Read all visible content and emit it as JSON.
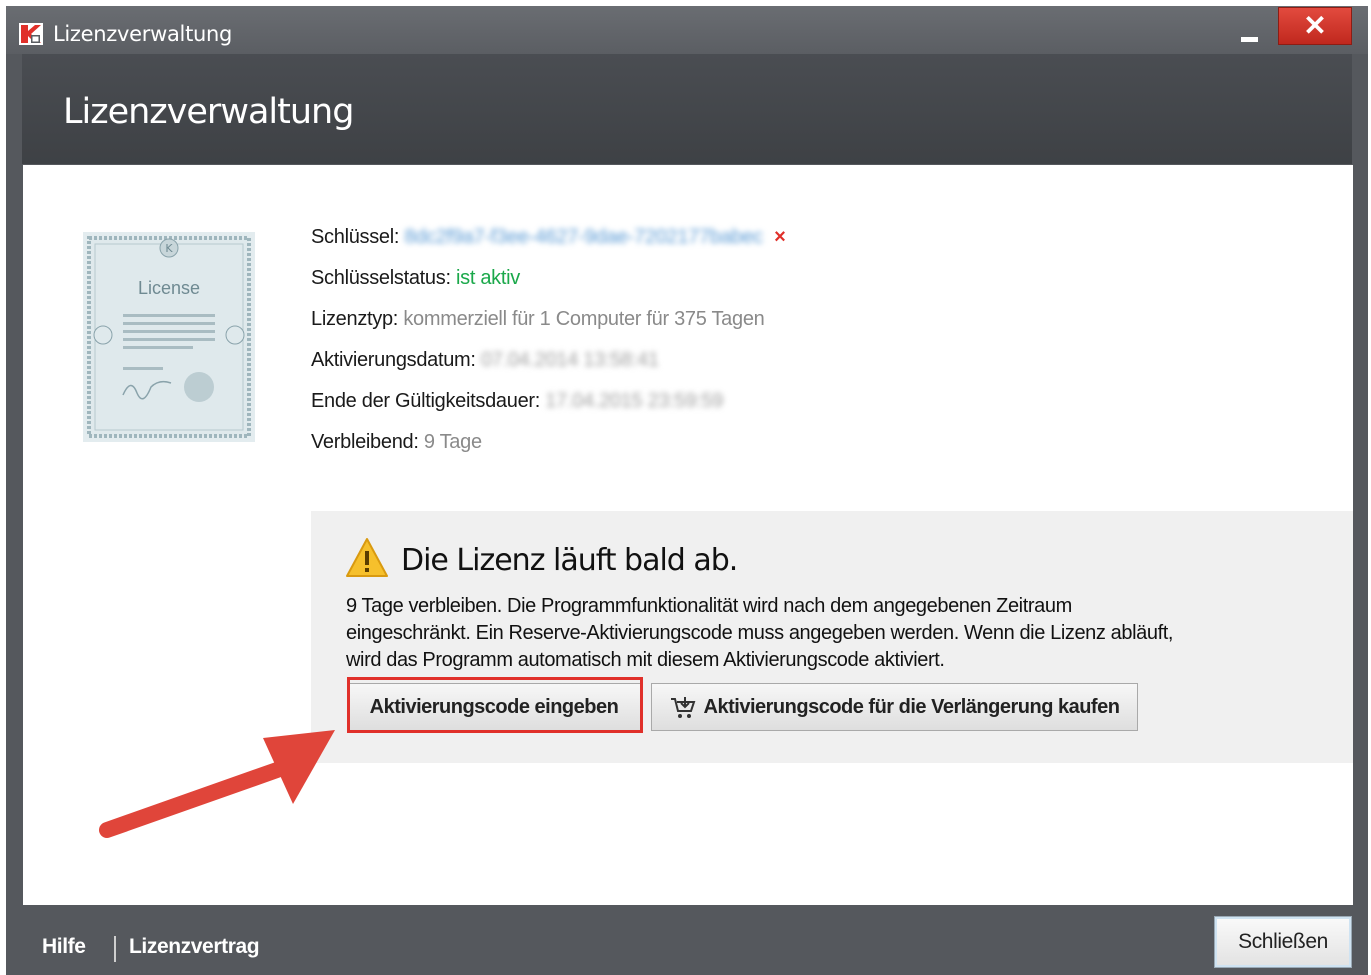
{
  "window": {
    "title": "Lizenzverwaltung",
    "close_label": "✕"
  },
  "header": {
    "title": "Lizenzverwaltung"
  },
  "certificate": {
    "label": "License"
  },
  "license": {
    "key_label": "Schlüssel:",
    "key_value": "8dc2f9a7-f3ee-4627-9dae-7202177babec",
    "key_remove": "×",
    "status_label": "Schlüsselstatus:",
    "status_value": "ist aktiv",
    "type_label": "Lizenztyp:",
    "type_value": "kommerziell für 1 Computer für 375 Tagen",
    "activation_label": "Aktivierungsdatum:",
    "activation_value": "07.04.2014 13:58:41",
    "expiry_label": "Ende der Gültigkeitsdauer:",
    "expiry_value": "17.04.2015 23:59:59",
    "remaining_label": "Verbleibend:",
    "remaining_value": "9 Tage"
  },
  "warning": {
    "title": "Die Lizenz läuft bald ab.",
    "line1": "9 Tage verbleiben. Die Programmfunktionalität wird nach dem angegebenen Zeitraum",
    "line2": "eingeschränkt. Ein Reserve-Aktivierungscode muss angegeben werden. Wenn die Lizenz abläuft,",
    "line3": "wird das Programm automatisch mit diesem Aktivierungscode aktiviert.",
    "btn_activate": "Aktivierungscode eingeben",
    "btn_buy": "Aktivierungscode für die Verlängerung kaufen"
  },
  "footer": {
    "help": "Hilfe",
    "license_agreement": "Lizenzvertrag",
    "close": "Schließen"
  },
  "colors": {
    "accent_red": "#e0302a",
    "status_green": "#1aa84a"
  }
}
